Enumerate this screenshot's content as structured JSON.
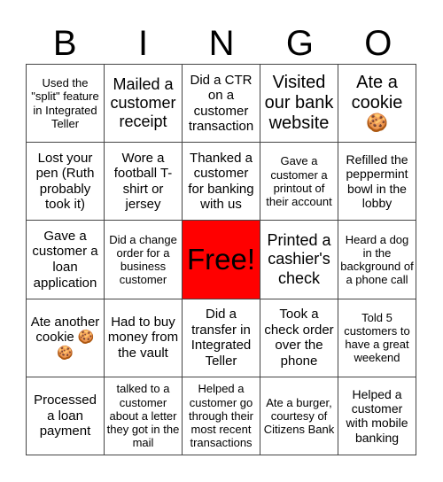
{
  "header": [
    "B",
    "I",
    "N",
    "G",
    "O"
  ],
  "cells": [
    "Used the \"split\" feature in Integrated Teller",
    "Mailed a customer receipt",
    "Did a CTR on a customer transaction",
    "Visited our bank website",
    "Ate a cookie 🍪",
    "Lost your pen (Ruth probably took it)",
    "Wore a football T-shirt or jersey",
    "Thanked a customer for banking with us",
    "Gave a customer a printout of their account",
    "Refilled the peppermint bowl in the lobby",
    "Gave a customer a loan application",
    "Did a change order for a business customer",
    "Free!",
    "Printed a cashier's check",
    "Heard a dog in the background of a phone call",
    "Ate another cookie 🍪🍪",
    "Had to buy money from the vault",
    "Did a transfer in Integrated Teller",
    "Took a check order over the phone",
    "Told 5 customers to have a great weekend",
    "Processed a loan payment",
    "talked to a customer about a letter they got in the mail",
    "Helped a customer go through their most recent transactions",
    "Ate a burger, courtesy of Citizens Bank",
    "Helped a customer with mobile banking"
  ],
  "free_color": "#ff0000"
}
